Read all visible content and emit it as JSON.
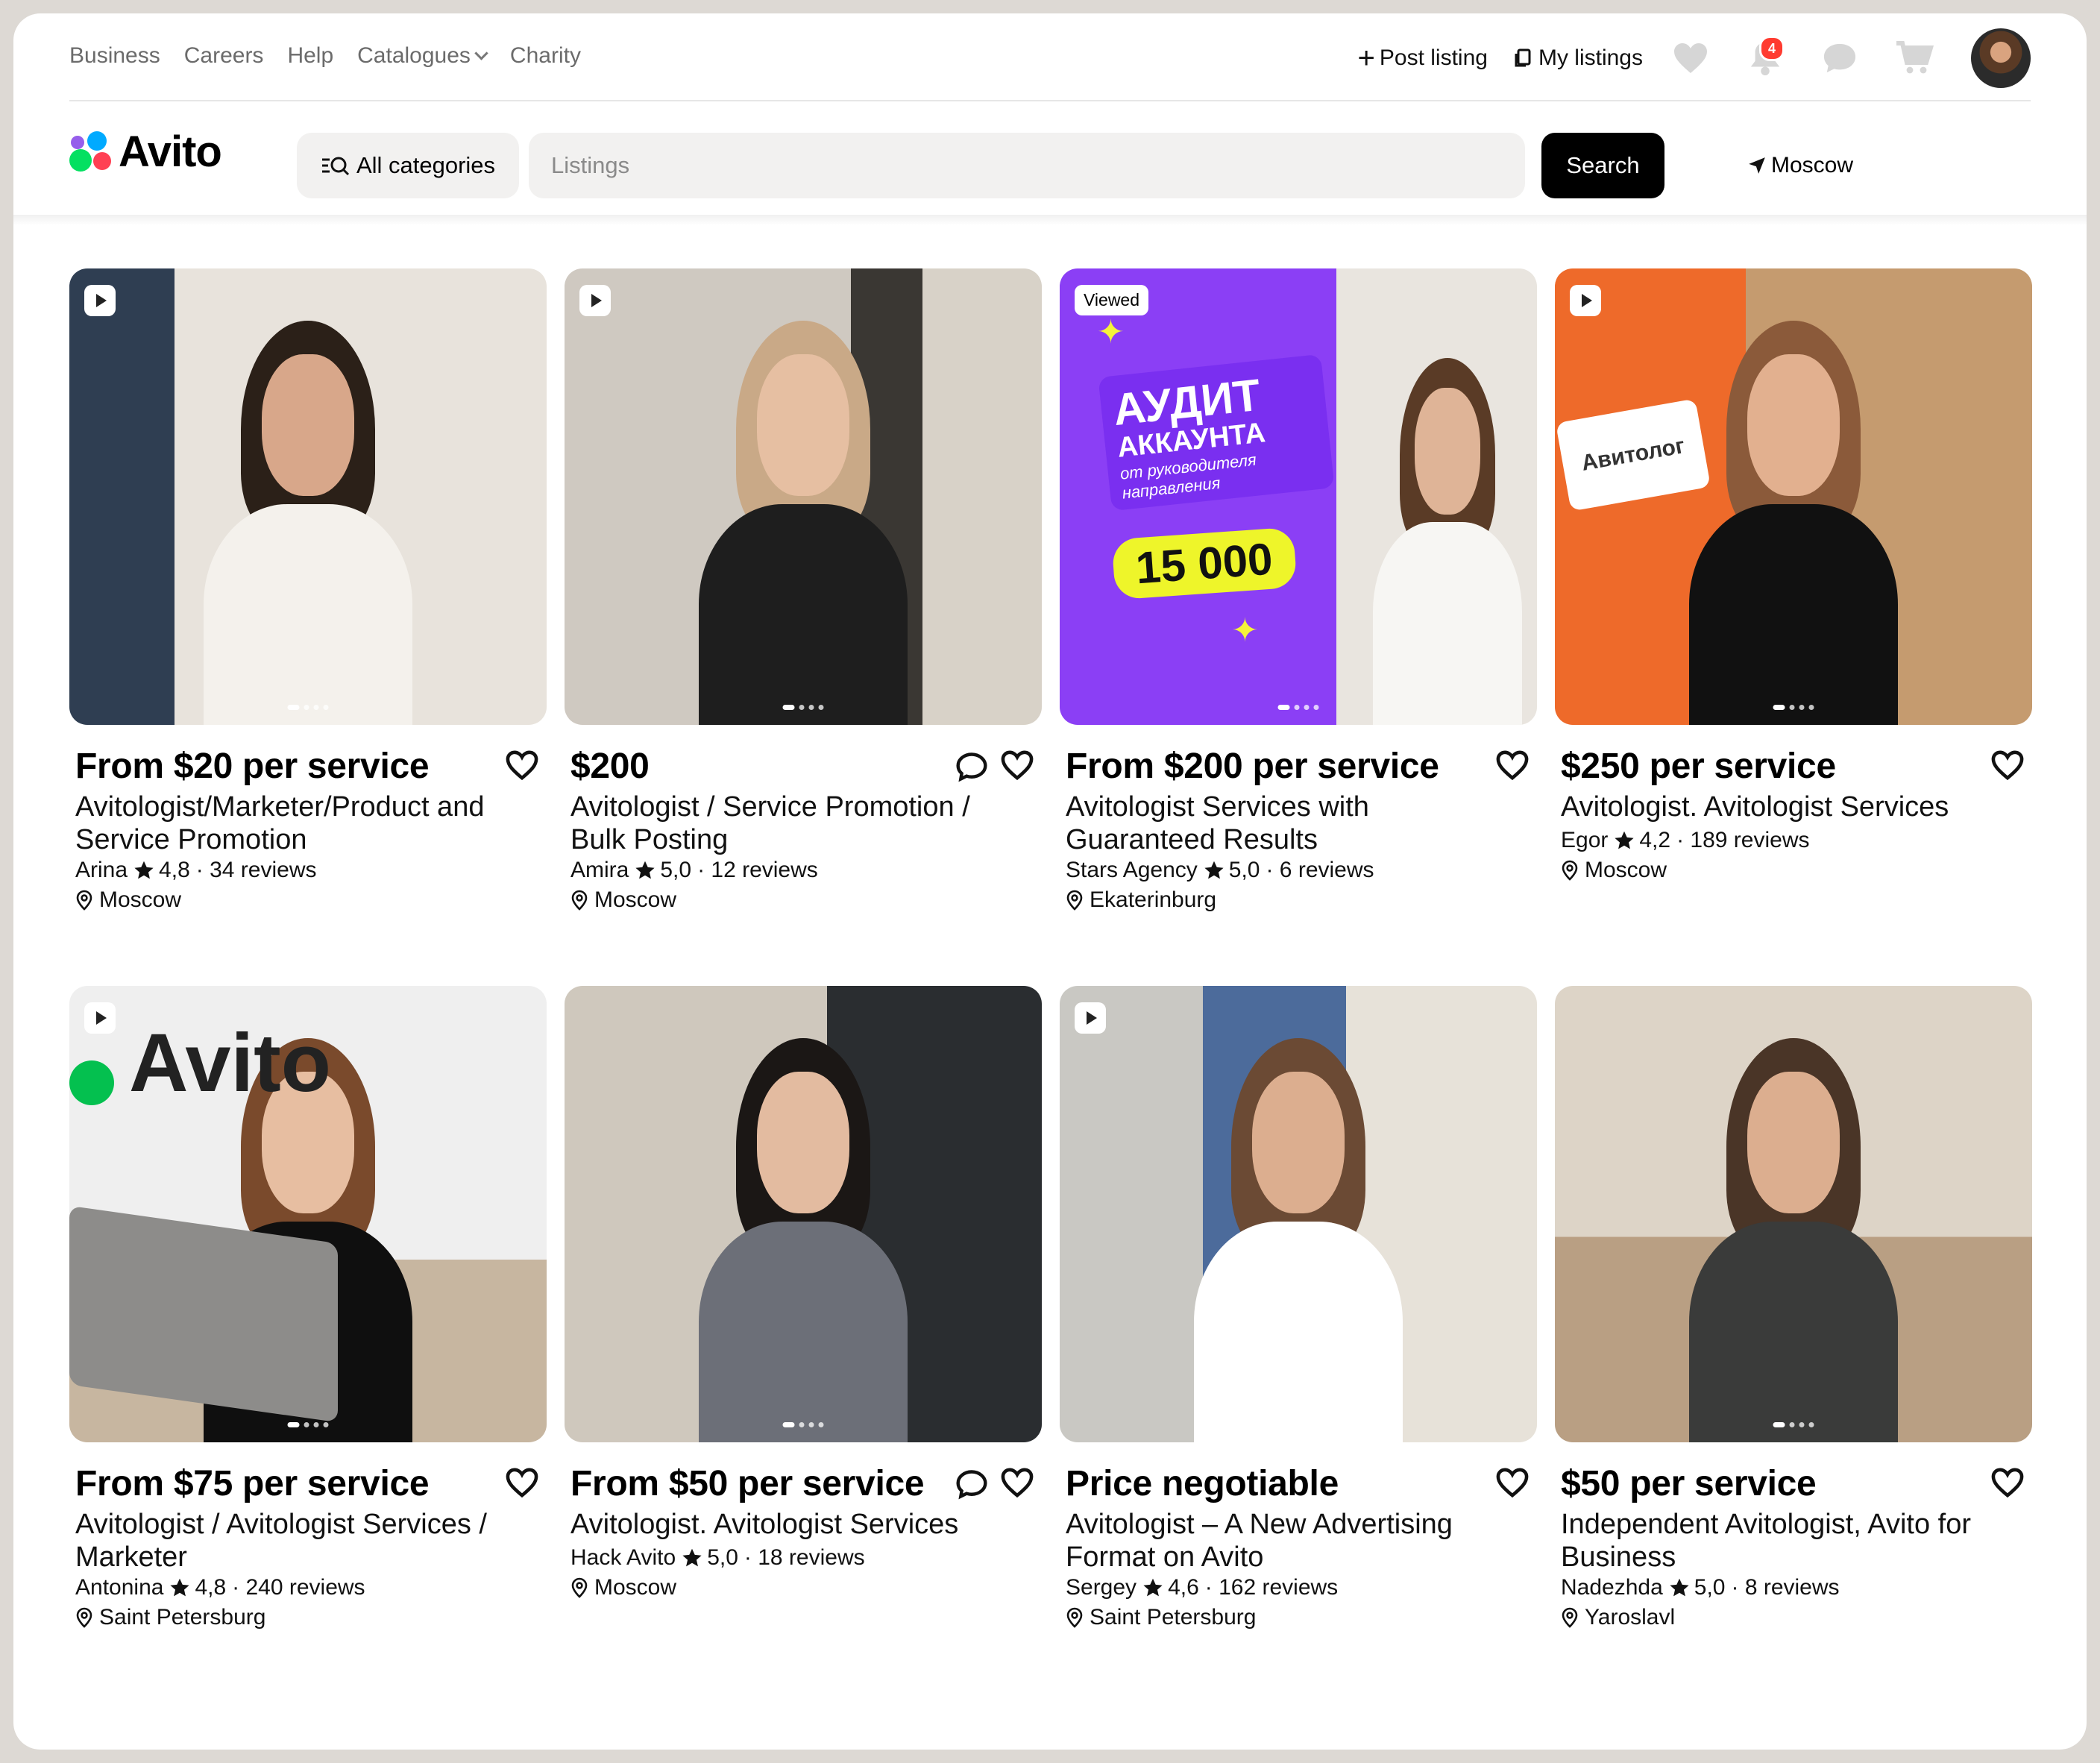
{
  "top_nav": {
    "links": [
      "Business",
      "Careers",
      "Help",
      "Catalogues",
      "Charity"
    ],
    "post_listing": "Post listing",
    "my_listings": "My listings",
    "notifications_count": "4"
  },
  "header": {
    "logo": "Avito",
    "categories_button": "All categories",
    "search_placeholder": "Listings",
    "search_button": "Search",
    "location": "Moscow"
  },
  "colors": {
    "accent": "#000000",
    "badge": "#ff3b30",
    "logo_dots": [
      "#00aaff",
      "#965eeb",
      "#ff4053",
      "#04e061"
    ]
  },
  "listings": [
    {
      "price": "From $20 per service",
      "title": "Avitologist/Marketer/Product and Service Promotion",
      "seller": "Arina",
      "rating": "4,8",
      "reviews": "· 34 reviews",
      "city": "Moscow",
      "badge": "play",
      "chat": false
    },
    {
      "price": "$200",
      "title": "Avitologist / Service Promotion / Bulk Posting",
      "seller": "Amira",
      "rating": "5,0",
      "reviews": "· 12 reviews",
      "city": "Moscow",
      "badge": "play",
      "chat": true
    },
    {
      "price": "From $200 per service",
      "title": "Avitologist Services with Guaranteed Results",
      "seller": "Stars Agency",
      "rating": "5,0",
      "reviews": "· 6 reviews",
      "city": "Ekaterinburg",
      "badge": "Viewed",
      "chat": false,
      "promo": {
        "line1": "АУДИТ",
        "line2": "АККАУНТА",
        "line3": "от руководителя",
        "line4": "направления",
        "amount": "15 000"
      }
    },
    {
      "price": "$250 per service",
      "title": "Avitologist. Avitologist Services",
      "seller": "Egor",
      "rating": "4,2",
      "reviews": "· 189 reviews",
      "city": "Moscow",
      "badge": "play",
      "chat": false,
      "sign": "Авитолог"
    },
    {
      "price": "From $75 per service",
      "title": "Avitologist / Avitologist Services / Marketer",
      "seller": "Antonina",
      "rating": "4,8",
      "reviews": "· 240 reviews",
      "city": "Saint Petersburg",
      "badge": "play",
      "chat": false,
      "wall": "Avito"
    },
    {
      "price": "From $50 per service",
      "title": "Avitologist. Avitologist Services",
      "seller": "Hack Avito",
      "rating": "5,0",
      "reviews": "· 18 reviews",
      "city": "Moscow",
      "badge": "none",
      "chat": true
    },
    {
      "price": "Price negotiable",
      "title": "Avitologist – A New Advertising Format on Avito",
      "seller": "Sergey",
      "rating": "4,6",
      "reviews": "· 162 reviews",
      "city": "Saint Petersburg",
      "badge": "play",
      "chat": false
    },
    {
      "price": "$50 per service",
      "title": "Independent Avitologist, Avito for Business",
      "seller": "Nadezhda",
      "rating": "5,0",
      "reviews": "· 8 reviews",
      "city": "Yaroslavl",
      "badge": "none",
      "chat": false
    }
  ]
}
